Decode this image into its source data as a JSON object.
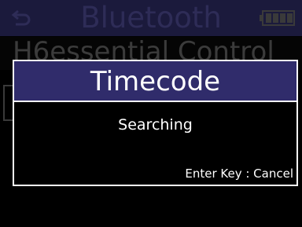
{
  "header": {
    "back_icon": "back-arrow-icon",
    "title": "Bluetooth",
    "battery_icon": "battery-icon"
  },
  "background_list": {
    "item_label": "H6essential Control"
  },
  "dialog": {
    "title": "Timecode",
    "message": "Searching",
    "hint": "Enter Key : Cancel",
    "titlebar_color": "#302c6b"
  }
}
